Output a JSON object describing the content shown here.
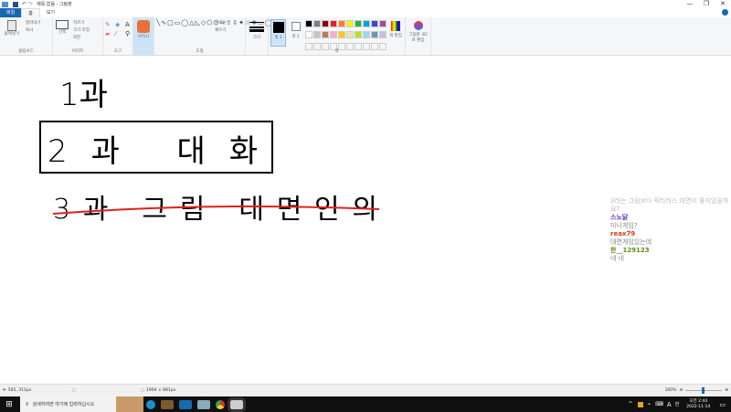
{
  "window": {
    "title": "제목 없음 - 그림판",
    "min": "—",
    "max": "❐",
    "close": "✕"
  },
  "tabs": [
    {
      "label": "파일"
    },
    {
      "label": "홈"
    },
    {
      "label": "보기"
    }
  ],
  "ribbon": {
    "clipboard": {
      "paste": "붙여넣기",
      "cut": "잘라내기",
      "copy": "복사",
      "label": "클립보드"
    },
    "image": {
      "select": "선택",
      "crop": "자르기",
      "resize": "크기 조정",
      "rotate": "회전",
      "label": "이미지"
    },
    "tools": {
      "label": "도구"
    },
    "brush": {
      "label": "브러시"
    },
    "shapes": {
      "outline": "윤곽선",
      "fill": "채우기",
      "label": "도형"
    },
    "size": {
      "label": "크기"
    },
    "colors": {
      "color1": "색 1",
      "color2": "색 2",
      "edit": "색 편집",
      "label": "색",
      "palette": [
        "#000000",
        "#7f7f7f",
        "#880015",
        "#ed1c24",
        "#ff7f27",
        "#fff200",
        "#22b14c",
        "#00a2e8",
        "#3f48cc",
        "#a349a4",
        "#ffffff",
        "#c3c3c3",
        "#b97a57",
        "#ffaec9",
        "#ffc90e",
        "#efe4b0",
        "#b5e61d",
        "#99d9ea",
        "#7092be",
        "#c8bfe7"
      ]
    },
    "paint3d": "그림판 3D로 편집"
  },
  "canvas": {
    "line1": "1과",
    "line2": "2과 대화",
    "line3": "3과 그림 대면인의"
  },
  "chat": [
    {
      "name": "",
      "msg": "3라는 그림보다 릭타러스 대면이 좋지않을까요?",
      "color": "#bbbbbb"
    },
    {
      "name": "스노닭",
      "msg": "미니게임?",
      "color": "#5b2fa8"
    },
    {
      "name": "reax79",
      "msg": "대면게임있는데",
      "color": "#d2401a"
    },
    {
      "name": "한__129123",
      "msg": "네 네",
      "color": "#5f8a1e"
    }
  ],
  "status": {
    "cursor": "565, 311px",
    "size": "1904 × 881px",
    "zoom": "100%"
  },
  "taskbar": {
    "search": "검색하려면 여기에 입력하십시오",
    "time": "오전 2:44",
    "date": "2022-11-14",
    "ime": "A",
    "lang": "한"
  }
}
